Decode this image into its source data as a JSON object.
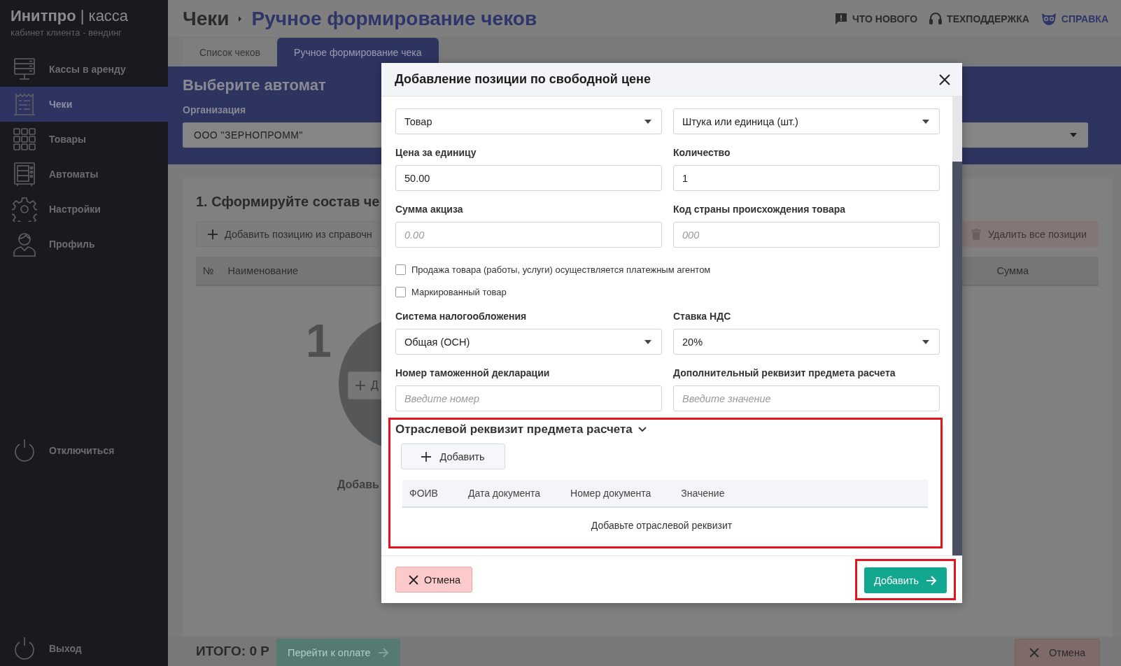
{
  "sidebar": {
    "logo": "**Инитпро** | касса",
    "subtitle": "кабинет клиента - вендинг",
    "items": [
      {
        "label": "Кассы в аренду",
        "selected": false
      },
      {
        "label": "Чеки",
        "selected": true
      },
      {
        "label": "Товары",
        "selected": false
      },
      {
        "label": "Автоматы",
        "selected": false
      },
      {
        "label": "Настройки",
        "selected": false
      },
      {
        "label": "Профиль",
        "selected": false
      }
    ],
    "disconnect": "Отключиться",
    "logout": "Выход"
  },
  "header": {
    "breadcrumb": "Чеки",
    "title": "Ручное формирование чеков",
    "links": [
      {
        "label": "ЧТО НОВОГО"
      },
      {
        "label": "ТЕХПОДДЕРЖКА"
      },
      {
        "label": "СПРАВКА"
      }
    ]
  },
  "tabs": [
    {
      "label": "Список чеков",
      "selected": false
    },
    {
      "label": "Ручное формирование чека",
      "selected": true
    }
  ],
  "machine_panel": {
    "title": "Выберите автомат",
    "org_label": "Организация",
    "org_value": "ООО \"ЗЕРНОПРОММ\""
  },
  "receipt": {
    "title": "1. Сформируйте состав че",
    "add_button": "Добавить позицию из справочн",
    "delete_button": "Удалить все позиции",
    "columns": [
      "№",
      "Наименование",
      "Сумма"
    ],
    "step_number": "1",
    "empty_button": "Д",
    "empty_text": "Добавь"
  },
  "footer": {
    "total": "ИТОГО: 0 Р",
    "pay_button": "Перейти к оплате",
    "cancel_button": "Отмена"
  },
  "modal": {
    "title": "Добавление позиции по свободной цене",
    "fields_top": [
      {
        "kind": "select",
        "value": "Товар"
      },
      {
        "kind": "select",
        "value": "Штука или единица (шт.)"
      },
      {
        "kind": "input",
        "label": "Цена за единицу",
        "value": "50.00"
      },
      {
        "kind": "input",
        "label": "Количество",
        "value": "1"
      },
      {
        "kind": "input",
        "label": "Сумма акциза",
        "placeholder": "0.00"
      },
      {
        "kind": "input",
        "label": "Код страны происхождения товара",
        "placeholder": "000"
      }
    ],
    "checkboxes": [
      {
        "label": "Продажа товара (работы, услуги) осуществляется платежным агентом",
        "checked": false
      },
      {
        "label": "Маркированный товар",
        "checked": false
      }
    ],
    "fields_bottom": [
      {
        "kind": "select",
        "label": "Система налогообложения",
        "value": "Общая (ОСН)"
      },
      {
        "kind": "select",
        "label": "Ставка НДС",
        "value": "20%"
      },
      {
        "kind": "input",
        "label": "Номер таможенной декларации",
        "placeholder": "Введите номер"
      },
      {
        "kind": "input",
        "label": "Дополнительный реквизит предмета расчета",
        "placeholder": "Введите значение"
      }
    ],
    "section": {
      "title": "Отраслевой реквизит предмета расчета",
      "expanded": true,
      "add_button": "Добавить",
      "columns": [
        "ФОИВ",
        "Дата документа",
        "Номер документа",
        "Значение"
      ],
      "empty_text": "Добавьте отраслевой реквизит"
    },
    "cancel_button": "Отмена",
    "submit_button": "Добавить"
  }
}
